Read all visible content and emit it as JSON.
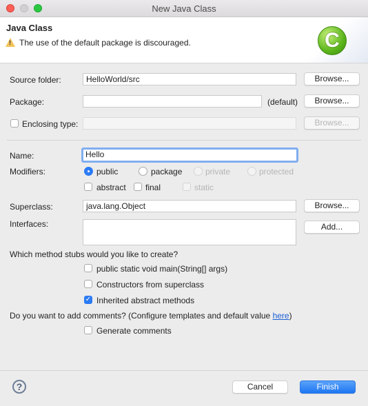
{
  "window": {
    "title": "New Java Class"
  },
  "header": {
    "title": "Java Class",
    "message": "The use of the default package is discouraged.",
    "logo_letter": "C"
  },
  "source_folder": {
    "label": "Source folder:",
    "value": "HelloWorld/src",
    "browse": "Browse..."
  },
  "package": {
    "label": "Package:",
    "value": "",
    "hint": "(default)",
    "browse": "Browse..."
  },
  "enclosing": {
    "label": "Enclosing type:",
    "value": "",
    "browse": "Browse...",
    "checked": false
  },
  "name": {
    "label": "Name:",
    "value": "Hello"
  },
  "modifiers": {
    "label": "Modifiers:",
    "radios": [
      {
        "label": "public",
        "selected": true,
        "enabled": true
      },
      {
        "label": "package",
        "selected": false,
        "enabled": true
      },
      {
        "label": "private",
        "selected": false,
        "enabled": false
      },
      {
        "label": "protected",
        "selected": false,
        "enabled": false
      }
    ],
    "checks": [
      {
        "label": "abstract",
        "checked": false,
        "enabled": true
      },
      {
        "label": "final",
        "checked": false,
        "enabled": true
      },
      {
        "label": "static",
        "checked": false,
        "enabled": false
      }
    ]
  },
  "superclass": {
    "label": "Superclass:",
    "value": "java.lang.Object",
    "browse": "Browse..."
  },
  "interfaces": {
    "label": "Interfaces:",
    "add": "Add..."
  },
  "stubs": {
    "question": "Which method stubs would you like to create?",
    "items": [
      {
        "label": "public static void main(String[] args)",
        "checked": false
      },
      {
        "label": "Constructors from superclass",
        "checked": false
      },
      {
        "label": "Inherited abstract methods",
        "checked": true
      }
    ]
  },
  "comments": {
    "question": "Do you want to add comments? (Configure templates and default value ",
    "link": "here",
    "close": ")",
    "item": {
      "label": "Generate comments",
      "checked": false
    }
  },
  "footer": {
    "cancel": "Cancel",
    "finish": "Finish",
    "help": "?"
  }
}
